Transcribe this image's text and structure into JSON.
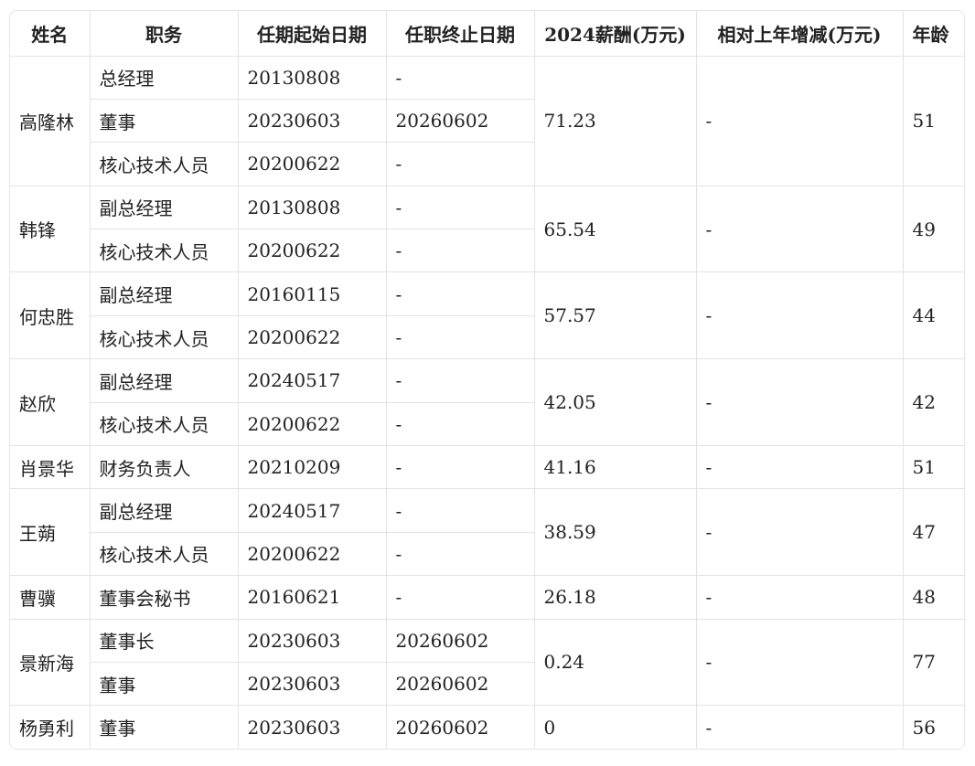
{
  "headers": [
    "姓名",
    "职务",
    "任期起始日期",
    "任职终止日期",
    "2024薪酬(万元)",
    "相对上年增减(万元)",
    "年龄"
  ],
  "people": [
    {
      "name": "高隆林",
      "salary": "71.23",
      "change": "-",
      "age": "51",
      "roles": [
        {
          "title": "总经理",
          "start": "20130808",
          "end": "-"
        },
        {
          "title": "董事",
          "start": "20230603",
          "end": "20260602"
        },
        {
          "title": "核心技术人员",
          "start": "20200622",
          "end": "-"
        }
      ]
    },
    {
      "name": "韩锋",
      "salary": "65.54",
      "change": "-",
      "age": "49",
      "roles": [
        {
          "title": "副总经理",
          "start": "20130808",
          "end": "-"
        },
        {
          "title": "核心技术人员",
          "start": "20200622",
          "end": "-"
        }
      ]
    },
    {
      "name": "何忠胜",
      "salary": "57.57",
      "change": "-",
      "age": "44",
      "roles": [
        {
          "title": "副总经理",
          "start": "20160115",
          "end": "-"
        },
        {
          "title": "核心技术人员",
          "start": "20200622",
          "end": "-"
        }
      ]
    },
    {
      "name": "赵欣",
      "salary": "42.05",
      "change": "-",
      "age": "42",
      "roles": [
        {
          "title": "副总经理",
          "start": "20240517",
          "end": "-"
        },
        {
          "title": "核心技术人员",
          "start": "20200622",
          "end": "-"
        }
      ]
    },
    {
      "name": "肖景华",
      "salary": "41.16",
      "change": "-",
      "age": "51",
      "roles": [
        {
          "title": "财务负责人",
          "start": "20210209",
          "end": "-"
        }
      ]
    },
    {
      "name": "王蒴",
      "salary": "38.59",
      "change": "-",
      "age": "47",
      "roles": [
        {
          "title": "副总经理",
          "start": "20240517",
          "end": "-"
        },
        {
          "title": "核心技术人员",
          "start": "20200622",
          "end": "-"
        }
      ]
    },
    {
      "name": "曹骥",
      "salary": "26.18",
      "change": "-",
      "age": "48",
      "roles": [
        {
          "title": "董事会秘书",
          "start": "20160621",
          "end": "-"
        }
      ]
    },
    {
      "name": "景新海",
      "salary": "0.24",
      "change": "-",
      "age": "77",
      "roles": [
        {
          "title": "董事长",
          "start": "20230603",
          "end": "20260602"
        },
        {
          "title": "董事",
          "start": "20230603",
          "end": "20260602"
        }
      ]
    },
    {
      "name": "杨勇利",
      "salary": "0",
      "change": "-",
      "age": "56",
      "roles": [
        {
          "title": "董事",
          "start": "20230603",
          "end": "20260602"
        }
      ]
    }
  ]
}
